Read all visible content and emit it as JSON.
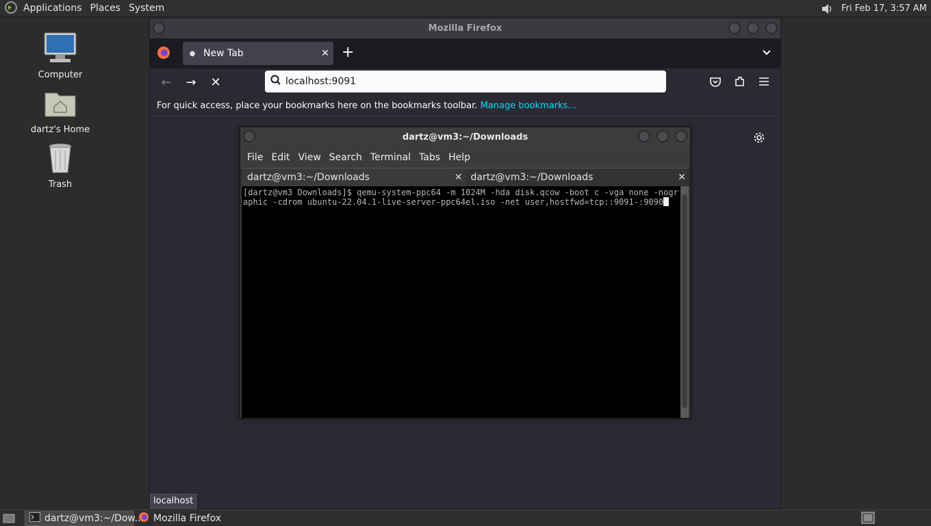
{
  "top_panel": {
    "menus": [
      "Applications",
      "Places",
      "System"
    ],
    "clock": "Fri Feb 17,  3:57 AM"
  },
  "desktop": {
    "icons": [
      {
        "label": "Computer",
        "icon": "computer-icon"
      },
      {
        "label": "dartz's Home",
        "icon": "home-folder-icon"
      },
      {
        "label": "Trash",
        "icon": "trash-icon"
      }
    ]
  },
  "firefox": {
    "window_title": "Mozilla Firefox",
    "tab": {
      "title": "New Tab",
      "close": "✕"
    },
    "new_tab_symbol": "+",
    "url": "localhost:9091",
    "bookmarks_bar": {
      "text": "For quick access, place your bookmarks here on the bookmarks toolbar.",
      "link": "Manage bookmarks…"
    },
    "status_tip": "localhost"
  },
  "terminal": {
    "window_title": "dartz@vm3:~/Downloads",
    "menus": [
      "File",
      "Edit",
      "View",
      "Search",
      "Terminal",
      "Tabs",
      "Help"
    ],
    "tabs": [
      "dartz@vm3:~/Downloads",
      "dartz@vm3:~/Downloads"
    ],
    "content": "[dartz@vm3 Downloads]$ qemu-system-ppc64 -m 1024M -hda disk.qcow -boot c -vga none -nographic -cdrom ubuntu-22.04.1-live-server-ppc64el.iso -net user,hostfwd=tcp::9091-:9090"
  },
  "taskbar": {
    "items": [
      "dartz@vm3:~/Dow...",
      "Mozilla Firefox"
    ]
  },
  "colors": {
    "firefox_bg": "#2b2a33",
    "link": "#00ddff",
    "terminal_bg": "#000000"
  }
}
